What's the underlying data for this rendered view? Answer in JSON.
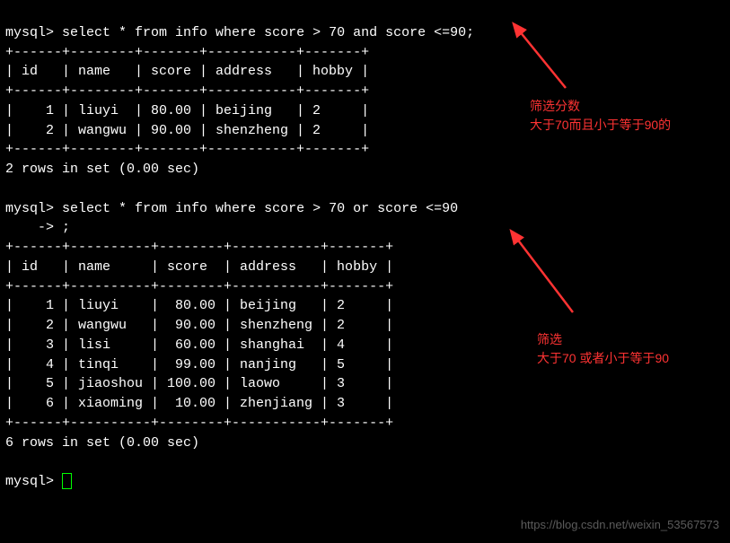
{
  "query1": {
    "prompt": "mysql>",
    "sql": "select * from info where score > 70 and score <=90;",
    "border_top": "+------+--------+-------+-----------+-------+",
    "header": "| id   | name   | score | address   | hobby |",
    "border_mid": "+------+--------+-------+-----------+-------+",
    "border_bottom": "+------+--------+-------+-----------+-------+",
    "rows": [
      "|    1 | liuyi  | 80.00 | beijing   | 2     |",
      "|    2 | wangwu | 90.00 | shenzheng | 2     |"
    ],
    "status": "2 rows in set (0.00 sec)"
  },
  "query2": {
    "prompt": "mysql>",
    "sql": "select * from info where score > 70 or score <=90",
    "continuation": "    -> ;",
    "border_top": "+------+----------+--------+-----------+-------+",
    "header": "| id   | name     | score  | address   | hobby |",
    "border_mid": "+------+----------+--------+-----------+-------+",
    "border_bottom": "+------+----------+--------+-----------+-------+",
    "rows": [
      "|    1 | liuyi    |  80.00 | beijing   | 2     |",
      "|    2 | wangwu   |  90.00 | shenzheng | 2     |",
      "|    3 | lisi     |  60.00 | shanghai  | 4     |",
      "|    4 | tinqi    |  99.00 | nanjing   | 5     |",
      "|    5 | jiaoshou | 100.00 | laowo     | 3     |",
      "|    6 | xiaoming |  10.00 | zhenjiang | 3     |"
    ],
    "status": "6 rows in set (0.00 sec)"
  },
  "trailing_prompt": "mysql>",
  "annotations": {
    "a1_line1": "筛选分数",
    "a1_line2": "大于70而且小于等于90的",
    "a2_line1": "筛选",
    "a2_line2": "大于70 或者小于等于90"
  },
  "watermark": "https://blog.csdn.net/weixin_53567573",
  "chart_data": {
    "type": "table",
    "tables": [
      {
        "title": "select * from info where score > 70 and score <=90",
        "columns": [
          "id",
          "name",
          "score",
          "address",
          "hobby"
        ],
        "rows": [
          [
            1,
            "liuyi",
            80.0,
            "beijing",
            2
          ],
          [
            2,
            "wangwu",
            90.0,
            "shenzheng",
            2
          ]
        ],
        "row_count": 2,
        "elapsed_sec": 0.0
      },
      {
        "title": "select * from info where score > 70 or score <=90",
        "columns": [
          "id",
          "name",
          "score",
          "address",
          "hobby"
        ],
        "rows": [
          [
            1,
            "liuyi",
            80.0,
            "beijing",
            2
          ],
          [
            2,
            "wangwu",
            90.0,
            "shenzheng",
            2
          ],
          [
            3,
            "lisi",
            60.0,
            "shanghai",
            4
          ],
          [
            4,
            "tinqi",
            99.0,
            "nanjing",
            5
          ],
          [
            5,
            "jiaoshou",
            100.0,
            "laowo",
            3
          ],
          [
            6,
            "xiaoming",
            10.0,
            "zhenjiang",
            3
          ]
        ],
        "row_count": 6,
        "elapsed_sec": 0.0
      }
    ]
  }
}
